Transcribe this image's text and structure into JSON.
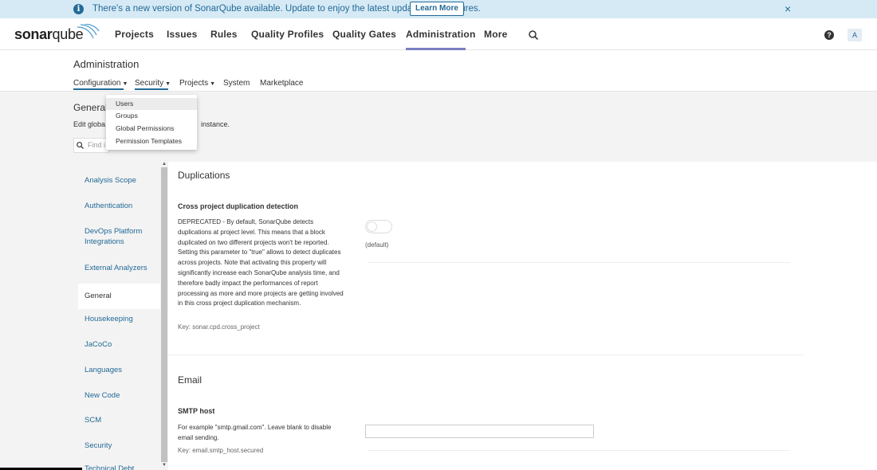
{
  "banner": {
    "message": "There's a new version of SonarQube available. Update to enjoy the latest updates and features.",
    "learn_more": "Learn More",
    "close": "×"
  },
  "logo": {
    "bold": "sonar",
    "light": "qube"
  },
  "nav": {
    "items": [
      "Projects",
      "Issues",
      "Rules",
      "Quality Profiles",
      "Quality Gates",
      "Administration",
      "More"
    ],
    "active": "Administration",
    "help": "?",
    "avatar": "A"
  },
  "admin": {
    "title": "Administration",
    "subnav": [
      "Configuration",
      "Security",
      "Projects",
      "System",
      "Marketplace"
    ]
  },
  "page": {
    "title": "General",
    "desc_left": "Edit globa",
    "desc_right": "instance.",
    "find_placeholder": "Find i"
  },
  "security_menu": [
    "Users",
    "Groups",
    "Global Permissions",
    "Permission Templates"
  ],
  "categories": [
    "Analysis Scope",
    "Authentication",
    "DevOps Platform Integrations",
    "External Analyzers",
    "General",
    "Housekeeping",
    "JaCoCo",
    "Languages",
    "New Code",
    "SCM",
    "Security",
    "Technical Debt"
  ],
  "selected_category": "General",
  "sections": {
    "duplications": {
      "title": "Duplications",
      "setting_title": "Cross project duplication detection",
      "description": "DEPRECATED - By default, SonarQube detects duplications at project level. This means that a block duplicated on two different projects won't be reported. Setting this parameter to \"true\" allows to detect duplicates across projects. Note that activating this property will significantly increase each SonarQube analysis time, and therefore badly impact the performances of report processing as more and more projects are getting involved in this cross project duplication mechanism.",
      "key": "Key: sonar.cpd.cross_project",
      "default_label": "(default)"
    },
    "email": {
      "title": "Email",
      "setting_title": "SMTP host",
      "description": "For example \"smtp.gmail.com\". Leave blank to disable email sending.",
      "key": "Key: email.smtp_host.secured",
      "value": ""
    }
  },
  "colors": {
    "banner_bg": "#d6eaf5",
    "link": "#236a97",
    "nav_accent": "#7b7fc1"
  }
}
